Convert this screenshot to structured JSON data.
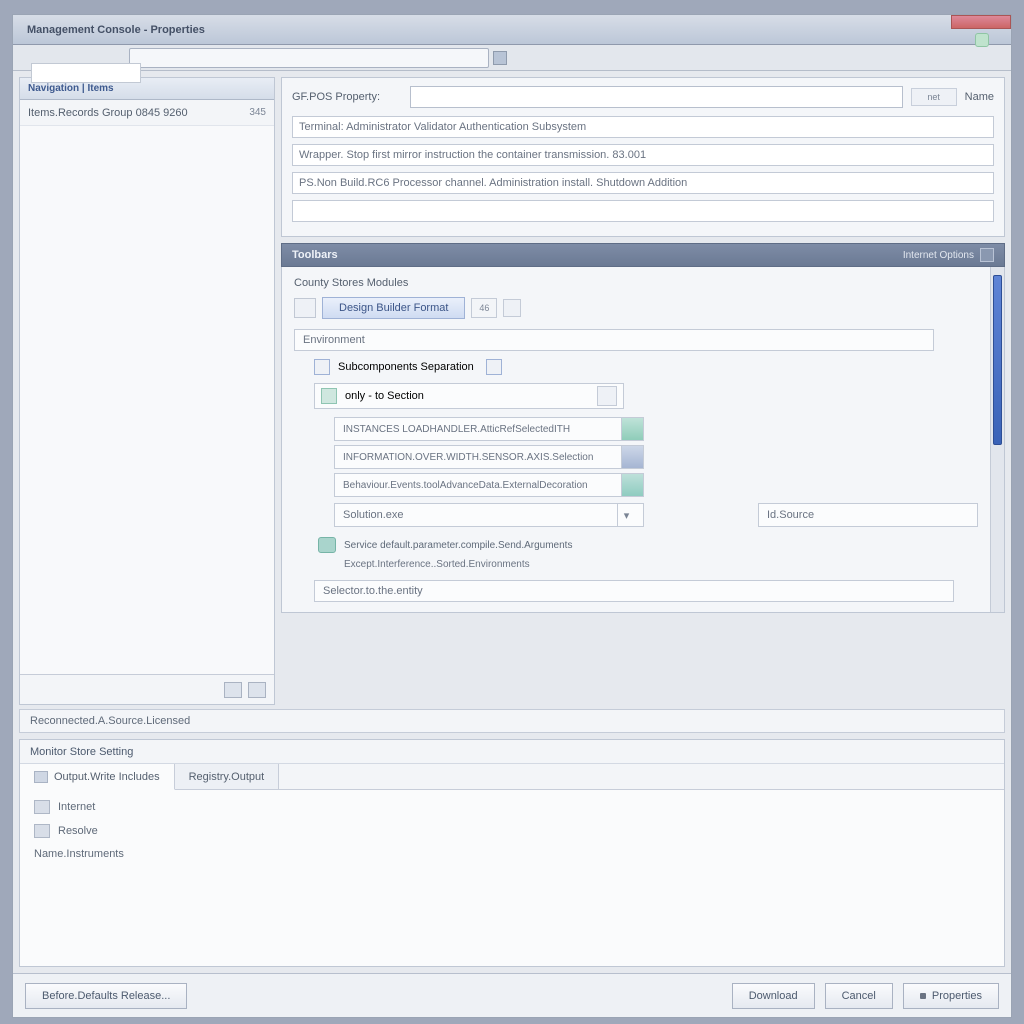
{
  "window": {
    "title": "Management Console - Properties"
  },
  "toolbar": {
    "address_value": ""
  },
  "sidebar": {
    "header": "Navigation | Items",
    "row1_label": "Items.Records Group 0845 9260",
    "row1_count": "345"
  },
  "top_panel": {
    "field_label": "GF.POS Property:",
    "field_value": "",
    "field_tag": "net",
    "after_label": "Name",
    "line1": "Terminal: Administrator Validator Authentication Subsystem",
    "line2": "Wrapper. Stop first mirror instruction the container transmission. 83.001",
    "line3": "PS.Non Build.RC6 Processor channel. Administration install. Shutdown Addition",
    "line4": ""
  },
  "section_bar": {
    "title": "Toolbars",
    "right": "Internet Options"
  },
  "options": {
    "subhead": "County Stores Modules",
    "tab_label": "Design Builder Format",
    "tab_count": "46",
    "box1": "Environment",
    "chk_label": "Subcomponents Separation",
    "inner_header": "only - to  Section",
    "pill1": "INSTANCES LOADHANDLER.AtticRefSelectedITH",
    "pill2": "INFORMATION.OVER.WIDTH.SENSOR.AXIS.Selection",
    "pill3": "Behaviour.Events.toolAdvanceData.ExternalDecoration",
    "left_field": "Solution.exe",
    "right_field": "Id.Source",
    "info1": "Service default.parameter.compile.Send.Arguments",
    "info2": "Except.Interference..Sorted.Environments",
    "bottom_box": "Selector.to.the.entity"
  },
  "status_strip": "Reconnected.A.Source.Licensed",
  "lower": {
    "title": "Monitor Store Setting",
    "tab1": "Output.Write Includes",
    "tab2": "Registry.Output",
    "item1": "Internet",
    "item2": "Resolve",
    "item3": "Name.Instruments"
  },
  "footer": {
    "left": "Before.Defaults Release...",
    "b1": "Download",
    "b2": "Cancel",
    "b3": "Properties"
  }
}
